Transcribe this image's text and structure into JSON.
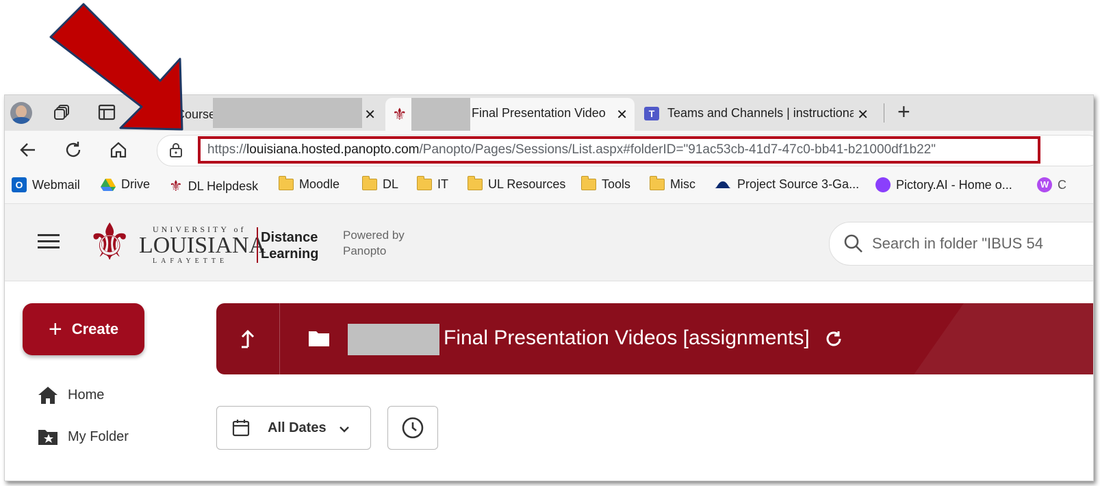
{
  "tabs": [
    {
      "label": "Course:",
      "close": "✕"
    },
    {
      "label": "Final Presentation Video",
      "close": "✕"
    },
    {
      "label": "Teams and Channels | instructiona",
      "close": "✕"
    }
  ],
  "new_tab": "+",
  "url": {
    "scheme": "https://",
    "host": "louisiana.hosted.panopto.com",
    "path": "/Panopto/Pages/Sessions/List.aspx#folderID=\"91ac53cb-41d7-47c0-bb41-b21000df1b22\""
  },
  "bookmarks": [
    {
      "label": "Webmail",
      "icon": "outlook-icon"
    },
    {
      "label": "Drive",
      "icon": "drive-icon"
    },
    {
      "label": "DL Helpdesk",
      "icon": "fleur-icon"
    },
    {
      "label": "Moodle",
      "icon": "folder-icon"
    },
    {
      "label": "DL",
      "icon": "folder-icon"
    },
    {
      "label": "IT",
      "icon": "folder-icon"
    },
    {
      "label": "UL Resources",
      "icon": "folder-icon"
    },
    {
      "label": "Tools",
      "icon": "folder-icon"
    },
    {
      "label": "Misc",
      "icon": "folder-icon"
    },
    {
      "label": "Project Source 3-Ga...",
      "icon": "hat-icon"
    },
    {
      "label": "Pictory.AI - Home o...",
      "icon": "pictory-icon"
    },
    {
      "label": "C",
      "icon": "w-icon"
    }
  ],
  "header": {
    "logo_top": "UNIVERSITY of",
    "logo_main": "LOUISIANA",
    "logo_bottom": "LAFAYETTE",
    "dl_line1": "Distance",
    "dl_line2": "Learning",
    "powered_line1": "Powered by",
    "powered_line2": "Panopto",
    "search_placeholder": "Search in folder \"IBUS 54"
  },
  "sidebar": {
    "create": "Create",
    "items": [
      {
        "label": "Home"
      },
      {
        "label": "My Folder"
      }
    ]
  },
  "folder": {
    "title": "Final Presentation Videos [assignments]"
  },
  "filters": {
    "dates": "All Dates"
  },
  "colors": {
    "brand_red": "#8a0e1c",
    "create_red": "#a00c1e",
    "highlight_border": "#b3081b",
    "arrow_red": "#c00000"
  }
}
